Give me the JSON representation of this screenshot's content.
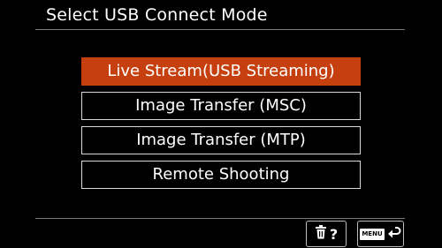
{
  "header": {
    "title": "Select USB Connect Mode"
  },
  "menu": {
    "options": [
      {
        "label": "Live Stream(USB Streaming)",
        "selected": true
      },
      {
        "label": "Image Transfer (MSC)",
        "selected": false
      },
      {
        "label": "Image Transfer (MTP)",
        "selected": false
      },
      {
        "label": "Remote Shooting",
        "selected": false
      }
    ]
  },
  "footer": {
    "help_glyph": "?",
    "menu_key_label": "MENU",
    "icons": [
      "trash-icon",
      "help-icon",
      "menu-key-icon",
      "return-arrow-icon"
    ]
  },
  "colors": {
    "background": "#000000",
    "selected_highlight": "#c6400f",
    "text": "#ffffff",
    "border": "#d9d9d9"
  }
}
